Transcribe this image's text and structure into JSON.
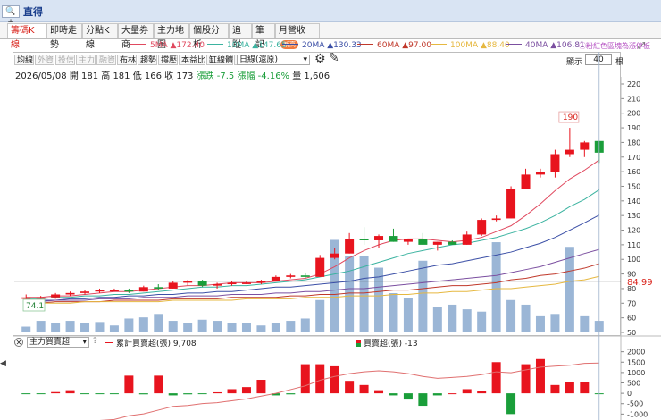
{
  "window": {
    "title": "直得",
    "control": "🔍+"
  },
  "tabs": [
    {
      "label": "籌碼K線",
      "active": true
    },
    {
      "label": "即時走勢"
    },
    {
      "label": "分點K線"
    },
    {
      "label": "大量券商"
    },
    {
      "label": "主力地圖"
    },
    {
      "label": "個股分析"
    },
    {
      "label": "追蹤"
    },
    {
      "label": "筆記"
    },
    {
      "label": "月營收",
      "badge": "新高"
    }
  ],
  "ma_legend": [
    {
      "label": "5MA ▲172.40",
      "color": "#e0495f"
    },
    {
      "label": "10MA ▲147.65",
      "color": "#3bb3a0"
    },
    {
      "label": "20MA ▲130.33",
      "color": "#3b4fa6"
    },
    {
      "label": "60MA ▲97.00",
      "color": "#c0392b"
    },
    {
      "label": "100MA ▲88.40",
      "color": "#e6b840"
    },
    {
      "label": "40MA ▲106.81",
      "color": "#7b4fa0"
    }
  ],
  "ma_note": "粉紅色區塊為漲停板",
  "toolbar": {
    "buttons": [
      {
        "label": "均線",
        "dim": false
      },
      {
        "label": "外資",
        "dim": true
      },
      {
        "label": "投信",
        "dim": true
      },
      {
        "label": "主力",
        "dim": true
      },
      {
        "label": "融資",
        "dim": true
      },
      {
        "label": "布林",
        "dim": false
      },
      {
        "label": "趨勢",
        "dim": false
      },
      {
        "label": "撐壓",
        "dim": false
      },
      {
        "label": "本益比",
        "dim": false
      },
      {
        "label": "缸線體",
        "dim": false
      },
      {
        "label": "分價圖",
        "dim": true
      }
    ],
    "period": "日線(還原)",
    "show_label": "顯示",
    "show_value": "40",
    "show_unit": "根"
  },
  "info": {
    "date_ohlc": "2026/05/08 開 181 高 181 低 166 收 173",
    "change": "漲跌 -7.5",
    "pct": "漲幅 -4.16%",
    "volume": "量 1,606"
  },
  "price_axis": {
    "ticks": [
      "220",
      "210",
      "200",
      "190",
      "180",
      "170",
      "160",
      "150",
      "140",
      "130",
      "120",
      "110",
      "100",
      "90",
      "80",
      "70",
      "60",
      "50"
    ],
    "current": "84.99",
    "high_label": "190",
    "low_label": "74.1"
  },
  "lower": {
    "selector": "主力買賣超",
    "q": "?",
    "legend1": "累計買賣超(張) 9,708",
    "legend2": "買賣超(張) -13",
    "ticks": [
      "2000",
      "1500",
      "1000",
      "500",
      "0",
      "-500",
      "-1000"
    ]
  },
  "colors": {
    "up": "#e8141e",
    "down": "#1a9e3a",
    "volume": "#9bb6d6"
  },
  "chart_data": {
    "type": "candlestick",
    "candles": [
      {
        "o": 73,
        "h": 76,
        "l": 72,
        "c": 74
      },
      {
        "o": 74,
        "h": 75,
        "l": 73,
        "c": 74
      },
      {
        "o": 74,
        "h": 77,
        "l": 73,
        "c": 76
      },
      {
        "o": 76,
        "h": 78,
        "l": 75,
        "c": 77
      },
      {
        "o": 77,
        "h": 79,
        "l": 76,
        "c": 78
      },
      {
        "o": 78,
        "h": 80,
        "l": 77,
        "c": 79
      },
      {
        "o": 79,
        "h": 80,
        "l": 78,
        "c": 79
      },
      {
        "o": 79,
        "h": 80,
        "l": 77,
        "c": 78
      },
      {
        "o": 78,
        "h": 82,
        "l": 78,
        "c": 81
      },
      {
        "o": 81,
        "h": 83,
        "l": 79,
        "c": 80
      },
      {
        "o": 80,
        "h": 85,
        "l": 80,
        "c": 84
      },
      {
        "o": 84,
        "h": 86,
        "l": 82,
        "c": 85
      },
      {
        "o": 85,
        "h": 86,
        "l": 81,
        "c": 82
      },
      {
        "o": 82,
        "h": 84,
        "l": 80,
        "c": 83
      },
      {
        "o": 83,
        "h": 85,
        "l": 82,
        "c": 84
      },
      {
        "o": 84,
        "h": 85,
        "l": 83,
        "c": 84
      },
      {
        "o": 84,
        "h": 86,
        "l": 83,
        "c": 85
      },
      {
        "o": 85,
        "h": 89,
        "l": 85,
        "c": 88
      },
      {
        "o": 88,
        "h": 90,
        "l": 87,
        "c": 89
      },
      {
        "o": 89,
        "h": 91,
        "l": 87,
        "c": 88
      },
      {
        "o": 88,
        "h": 103,
        "l": 88,
        "c": 101
      },
      {
        "o": 101,
        "h": 108,
        "l": 100,
        "c": 104
      },
      {
        "o": 104,
        "h": 118,
        "l": 104,
        "c": 114
      },
      {
        "o": 114,
        "h": 122,
        "l": 110,
        "c": 113
      },
      {
        "o": 113,
        "h": 117,
        "l": 108,
        "c": 116
      },
      {
        "o": 116,
        "h": 121,
        "l": 112,
        "c": 112
      },
      {
        "o": 112,
        "h": 114,
        "l": 110,
        "c": 114
      },
      {
        "o": 114,
        "h": 118,
        "l": 110,
        "c": 110
      },
      {
        "o": 110,
        "h": 112,
        "l": 106,
        "c": 112
      },
      {
        "o": 112,
        "h": 113,
        "l": 110,
        "c": 110
      },
      {
        "o": 110,
        "h": 119,
        "l": 110,
        "c": 117
      },
      {
        "o": 117,
        "h": 128,
        "l": 116,
        "c": 127
      },
      {
        "o": 127,
        "h": 130,
        "l": 126,
        "c": 128
      },
      {
        "o": 128,
        "h": 150,
        "l": 128,
        "c": 148
      },
      {
        "o": 148,
        "h": 162,
        "l": 148,
        "c": 158
      },
      {
        "o": 158,
        "h": 162,
        "l": 156,
        "c": 160
      },
      {
        "o": 160,
        "h": 175,
        "l": 156,
        "c": 172
      },
      {
        "o": 172,
        "h": 190,
        "l": 170,
        "c": 175
      },
      {
        "o": 175,
        "h": 181,
        "l": 170,
        "c": 180
      },
      {
        "o": 181,
        "h": 181,
        "l": 166,
        "c": 173
      }
    ],
    "volume": [
      5,
      10,
      8,
      10,
      8,
      9,
      6,
      12,
      13,
      16,
      10,
      8,
      11,
      10,
      8,
      8,
      6,
      8,
      10,
      12,
      28,
      80,
      66,
      66,
      56,
      34,
      30,
      62,
      22,
      24,
      20,
      18,
      78,
      28,
      24,
      14,
      16,
      74,
      14,
      10
    ],
    "ma5": [
      74,
      74,
      75,
      75,
      76,
      77,
      78,
      78,
      79,
      80,
      81,
      82,
      82,
      83,
      84,
      84,
      84,
      85,
      86,
      87,
      90,
      95,
      101,
      106,
      110,
      113,
      114,
      114,
      113,
      112,
      113,
      115,
      119,
      123,
      130,
      138,
      147,
      155,
      161,
      168,
      172.4
    ],
    "ma10": [
      73,
      73,
      74,
      74,
      75,
      75,
      76,
      76,
      77,
      78,
      79,
      80,
      81,
      81,
      82,
      82,
      83,
      84,
      85,
      86,
      88,
      90,
      92,
      95,
      98,
      101,
      104,
      106,
      108,
      110,
      111,
      113,
      115,
      118,
      121,
      125,
      130,
      136,
      141,
      147.65
    ],
    "ma20": [
      72,
      72,
      72,
      73,
      73,
      74,
      74,
      75,
      75,
      76,
      76,
      77,
      77,
      78,
      78,
      79,
      80,
      81,
      81,
      82,
      83,
      84,
      85,
      87,
      88,
      90,
      92,
      94,
      96,
      97,
      99,
      101,
      103,
      105,
      108,
      111,
      115,
      120,
      125,
      130.33
    ],
    "ma40": [
      71,
      71,
      72,
      72,
      72,
      73,
      73,
      73,
      74,
      74,
      74,
      75,
      75,
      75,
      76,
      76,
      76,
      77,
      77,
      78,
      78,
      79,
      80,
      80,
      81,
      82,
      83,
      84,
      85,
      86,
      87,
      88,
      89,
      91,
      93,
      95,
      98,
      101,
      104,
      106.81
    ],
    "ma60": [
      70,
      70,
      71,
      71,
      71,
      71,
      72,
      72,
      72,
      72,
      73,
      73,
      73,
      73,
      74,
      74,
      74,
      74,
      75,
      75,
      76,
      76,
      77,
      77,
      78,
      79,
      79,
      80,
      81,
      82,
      82,
      83,
      84,
      86,
      87,
      89,
      90,
      92,
      94,
      97
    ],
    "ma100": [
      70,
      70,
      70,
      70,
      71,
      71,
      71,
      71,
      71,
      71,
      72,
      72,
      72,
      72,
      72,
      73,
      73,
      73,
      73,
      74,
      74,
      74,
      75,
      75,
      75,
      76,
      76,
      77,
      77,
      78,
      78,
      79,
      80,
      80,
      81,
      82,
      83,
      85,
      86,
      88.4
    ],
    "net": [
      -30,
      -20,
      60,
      150,
      -30,
      -40,
      -40,
      850,
      -50,
      850,
      -100,
      -50,
      -10,
      50,
      200,
      300,
      650,
      -100,
      -50,
      1400,
      1400,
      1300,
      600,
      400,
      150,
      -100,
      -300,
      -600,
      -100,
      0,
      200,
      100,
      1500,
      -1000,
      1400,
      1650,
      400,
      550,
      550,
      -13
    ],
    "cum": [
      -1800,
      -1750,
      -1700,
      -1600,
      -1500,
      -1450,
      -1400,
      -1200,
      -1100,
      -900,
      -700,
      -650,
      -550,
      -500,
      -400,
      -300,
      -150,
      0,
      200,
      400,
      700,
      900,
      1050,
      1150,
      1200,
      1150,
      1050,
      900,
      800,
      850,
      900,
      1000,
      1150,
      1100,
      1250,
      1400,
      1450,
      1500,
      1600,
      1620
    ]
  }
}
